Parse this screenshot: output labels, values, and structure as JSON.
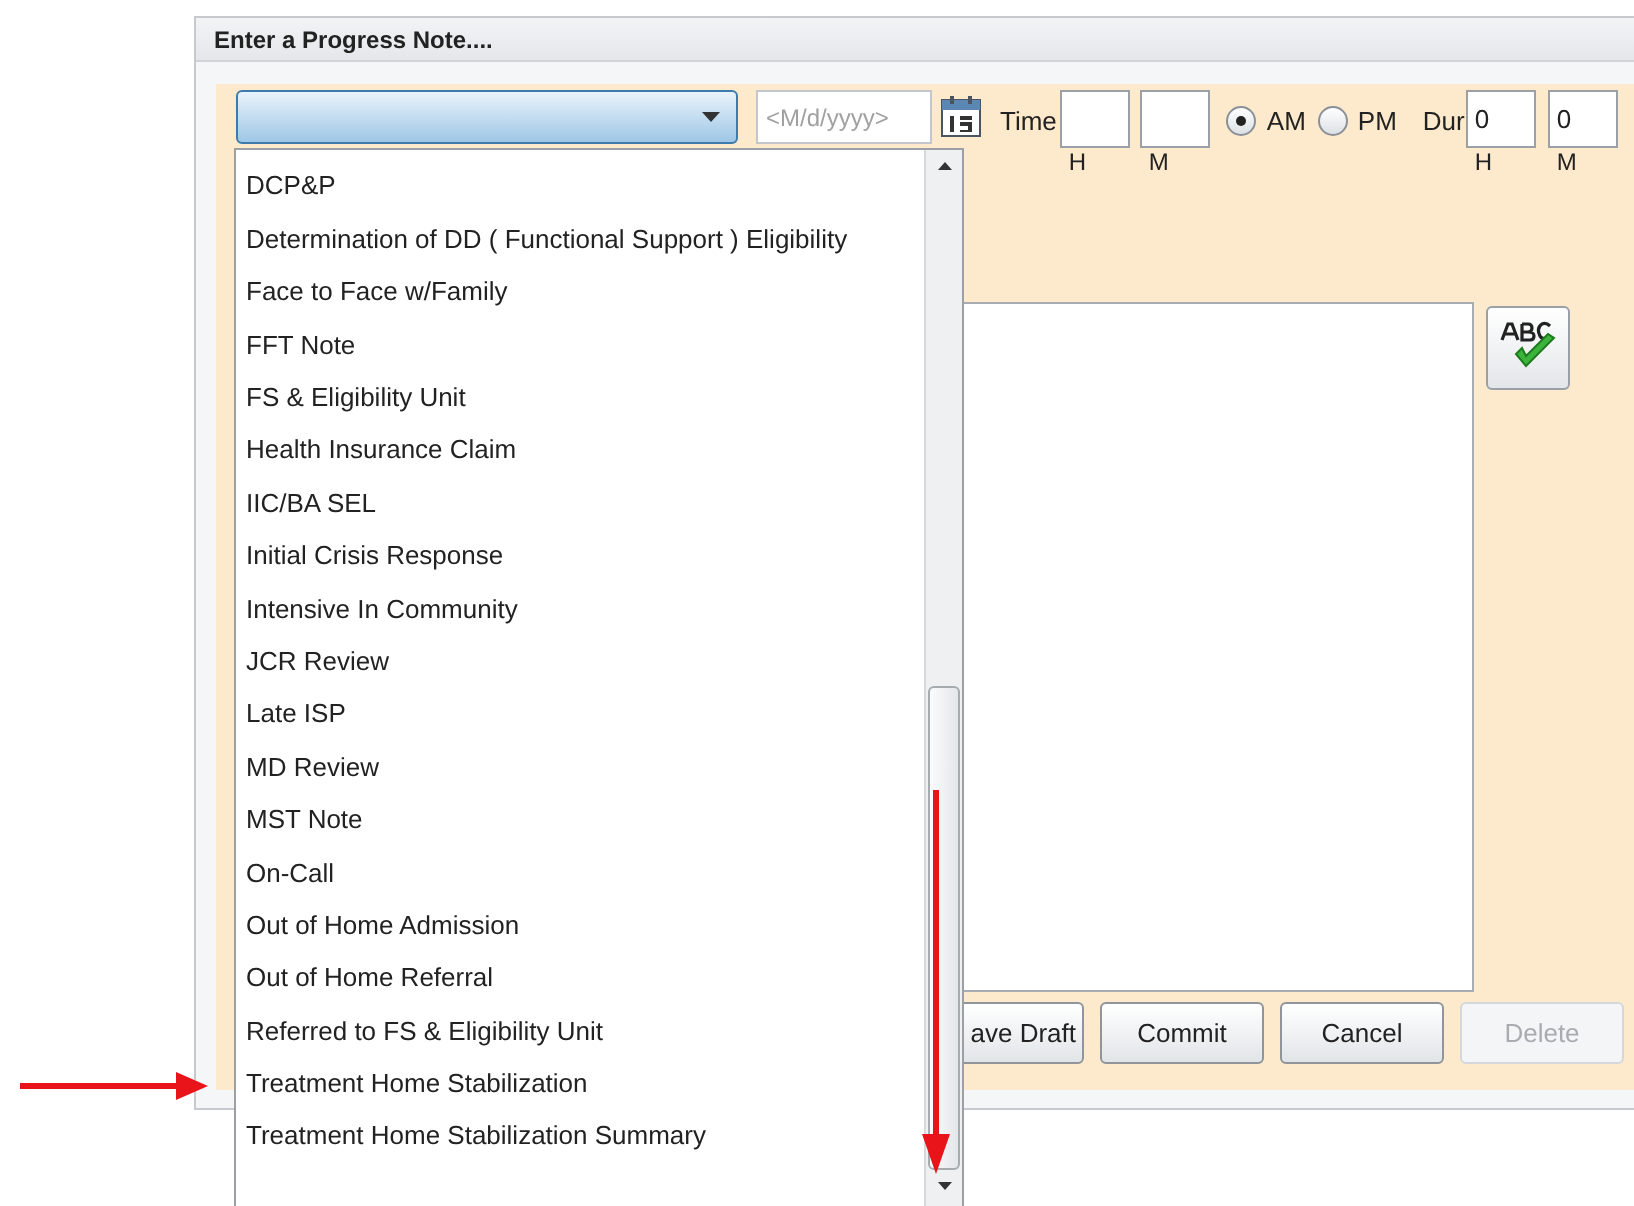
{
  "dialog": {
    "title": "Enter a Progress Note...."
  },
  "note_type": {
    "expanded": true,
    "options": [
      {
        "label": "DCP&P"
      },
      {
        "label": "Determination of DD ( Functional Support ) Eligibility"
      },
      {
        "label": "Face to Face w/Family"
      },
      {
        "label": "FFT Note"
      },
      {
        "label": "FS & Eligibility Unit"
      },
      {
        "label": "Health Insurance Claim"
      },
      {
        "label": "IIC/BA SEL"
      },
      {
        "label": "Initial Crisis Response"
      },
      {
        "label": "Intensive In Community"
      },
      {
        "label": "JCR Review"
      },
      {
        "label": "Late ISP"
      },
      {
        "label": "MD Review"
      },
      {
        "label": "MST Note"
      },
      {
        "label": "On-Call"
      },
      {
        "label": "Out of Home Admission"
      },
      {
        "label": "Out of Home Referral"
      },
      {
        "label": "Referred to FS & Eligibility Unit"
      },
      {
        "label": "Treatment Home Stabilization"
      },
      {
        "label": "Treatment Home Stabilization Summary"
      }
    ]
  },
  "date": {
    "placeholder": "<M/d/yyyy>"
  },
  "time": {
    "label": "Time",
    "hour_caption": "H",
    "minute_caption": "M"
  },
  "meridiem": [
    {
      "label": "AM",
      "selected": true
    },
    {
      "label": "PM",
      "selected": false
    }
  ],
  "duration": {
    "label": "Dur",
    "hour_value": "0",
    "minute_value": "0",
    "hour_caption": "H",
    "minute_caption": "M"
  },
  "buttons": [
    {
      "label": "ave Draft",
      "disabled": false
    },
    {
      "label": "Commit",
      "disabled": false
    },
    {
      "label": "Cancel",
      "disabled": false
    },
    {
      "label": "Delete",
      "disabled": true
    }
  ]
}
